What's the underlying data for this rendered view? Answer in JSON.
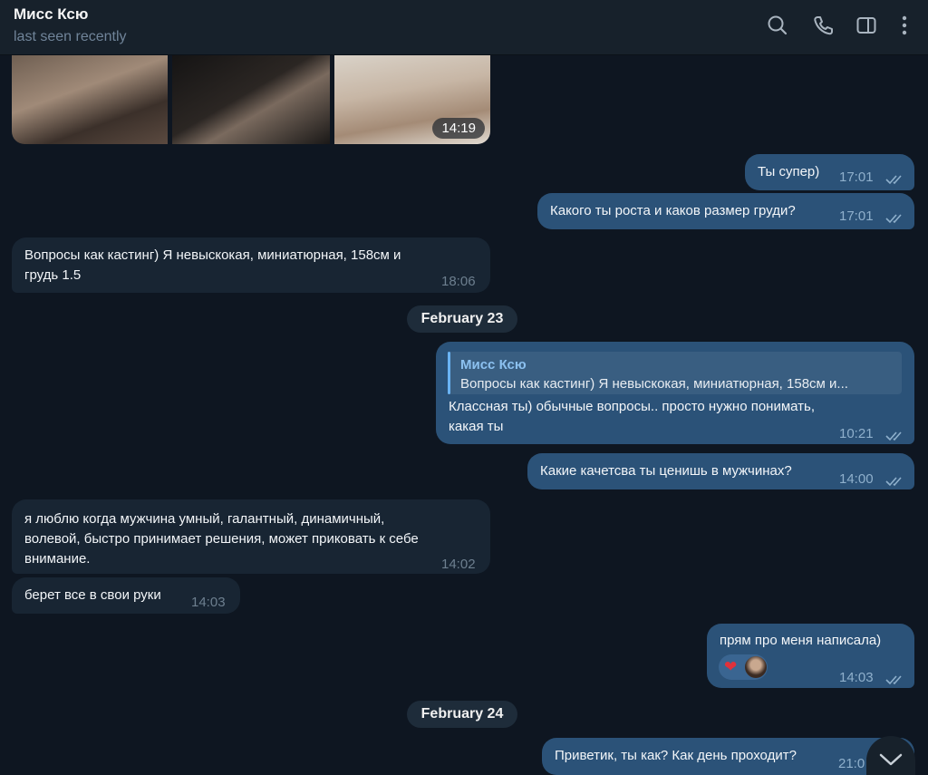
{
  "header": {
    "title": "Мисс Ксю",
    "status": "last seen recently",
    "icons": [
      "search-icon",
      "phone-icon",
      "sidebar-toggle-icon",
      "more-icon"
    ]
  },
  "album": {
    "time": "14:19"
  },
  "messages": {
    "m1": {
      "text": "Ты супер)",
      "time": "17:01"
    },
    "m2": {
      "text": "Какого ты роста и каков размер груди?",
      "time": "17:01"
    },
    "m3": {
      "line1": "Вопросы как кастинг) Я невыскокая, миниатюрная, 158см и",
      "line2": "грудь 1.5",
      "time": "18:06"
    },
    "m4": {
      "reply_name": "Мисс Ксю",
      "reply_text": "Вопросы как кастинг) Я невыскокая, миниатюрная, 158см и...",
      "line1": "Классная ты) обычные вопросы.. просто нужно понимать,",
      "line2": "какая ты",
      "time": "10:21"
    },
    "m5": {
      "text": "Какие качетсва ты ценишь в мужчинах?",
      "time": "14:00"
    },
    "m6": {
      "line1": "я люблю когда мужчина умный, галантный, динамичный,",
      "line2": "волевой, быстро принимает решения, может приковать к себе",
      "line3": "внимание.",
      "time": "14:02"
    },
    "m7": {
      "text": "берет все в свои руки",
      "time": "14:03"
    },
    "m8": {
      "text": "прям про меня написала)",
      "time": "14:03",
      "reaction": "❤"
    },
    "m9": {
      "text": "Приветик, ты как? Как день проходит?",
      "time": "21:0"
    }
  },
  "dates": {
    "d1": "February 23",
    "d2": "February 24"
  },
  "colors": {
    "background": "#0e1621",
    "outgoing": "#2b5278",
    "incoming": "#182533",
    "accent": "#6ab3f3"
  }
}
